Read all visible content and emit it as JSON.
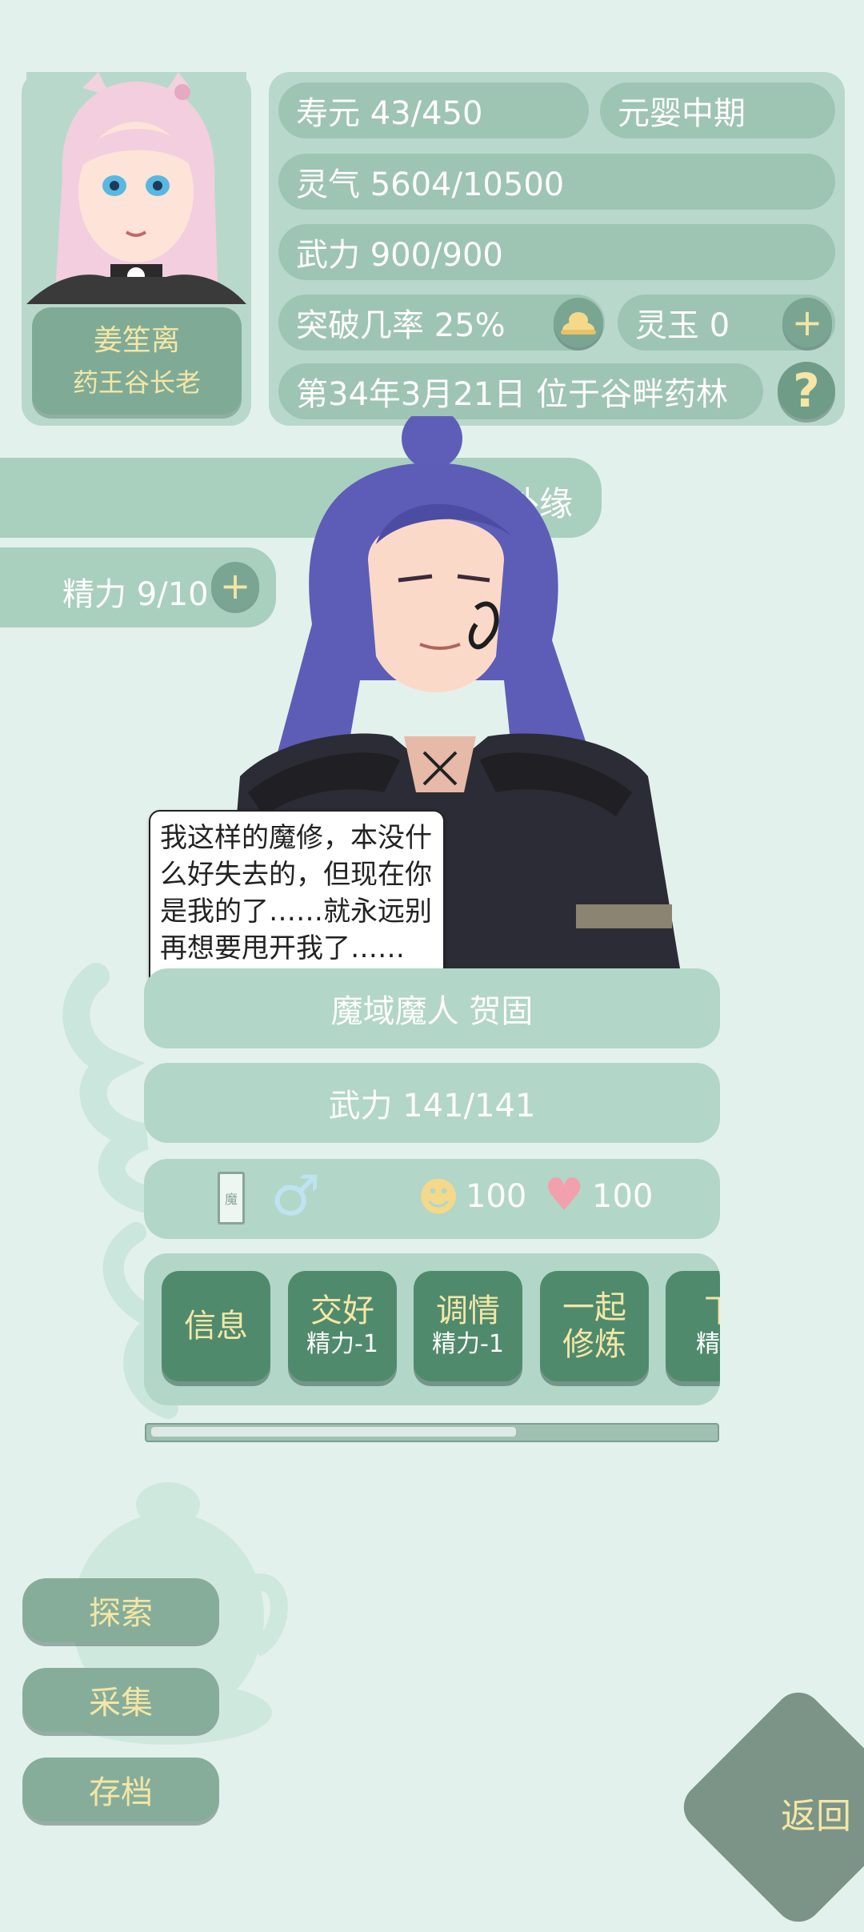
{
  "colors": {
    "background": "#e3f1ec",
    "panel": "#b8d8cc",
    "pill": "#9ec4b4",
    "button_dark": "#4f8a6d",
    "gold_text": "#f4e6a6",
    "back_button": "#7b9487"
  },
  "profile": {
    "name": "姜笙离",
    "title": "药王谷长老"
  },
  "stats": {
    "lifespan": "寿元 43/450",
    "realm": "元婴中期",
    "spirit_qi": "灵气 5604/10500",
    "martial": "武力 900/900",
    "breakthrough": "突破几率 25%",
    "spirit_jade": "灵玉 0",
    "date_location": "第34年3月21日 位于谷畔药林"
  },
  "icons": {
    "breakthrough_icon": "golden-cloud-icon",
    "plus_icon": "+",
    "help_icon": "?",
    "gender_icon": "♂",
    "mood_icon": "☻",
    "affection_icon": "♥"
  },
  "fate_bar": {
    "label_visible": "外缘"
  },
  "energy": {
    "label": "精力 9/10"
  },
  "npc": {
    "dialogue": "我这样的魔修，本没什么好失去的，但现在你是我的了……就永远别再想要甩开我了……",
    "name_line": "魔域魔人 贺固",
    "martial": "武力 141/141",
    "mood_value": "100",
    "affection_value": "100",
    "card_glyph": "魔"
  },
  "actions": [
    {
      "main": "信息",
      "sub": ""
    },
    {
      "main": "交好",
      "sub": "精力-1"
    },
    {
      "main": "调情",
      "sub": "精力-1"
    },
    {
      "main": "一起修炼",
      "sub": ""
    },
    {
      "main": "下",
      "sub": "精力"
    }
  ],
  "scroll_progress": 0.64,
  "menu": {
    "explore": "探索",
    "gather": "采集",
    "save": "存档"
  },
  "back": "返回"
}
